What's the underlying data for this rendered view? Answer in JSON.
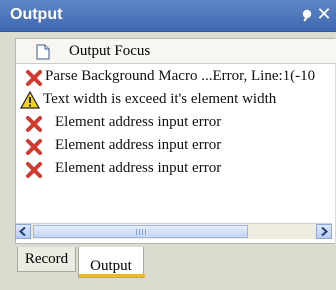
{
  "panel": {
    "title": "Output"
  },
  "colors": {
    "titlebar": "#4a75bc",
    "error": "#d33a2f",
    "warning": "#f2d21b",
    "tab_accent": "#f2b33d"
  },
  "list": {
    "header": {
      "icon": "document-icon",
      "label": "Output Focus"
    },
    "rows": [
      {
        "icon": "error-icon",
        "text": "Parse Background Macro ...Error, Line:1(-10"
      },
      {
        "icon": "warning-icon",
        "text": "Text width is exceed it's element width"
      },
      {
        "icon": "error-icon",
        "text": "Element address input error"
      },
      {
        "icon": "error-icon",
        "text": "Element address input error"
      },
      {
        "icon": "error-icon",
        "text": "Element address input error"
      }
    ]
  },
  "tabs": [
    {
      "label": "Record",
      "active": false
    },
    {
      "label": "Output",
      "active": true
    }
  ]
}
